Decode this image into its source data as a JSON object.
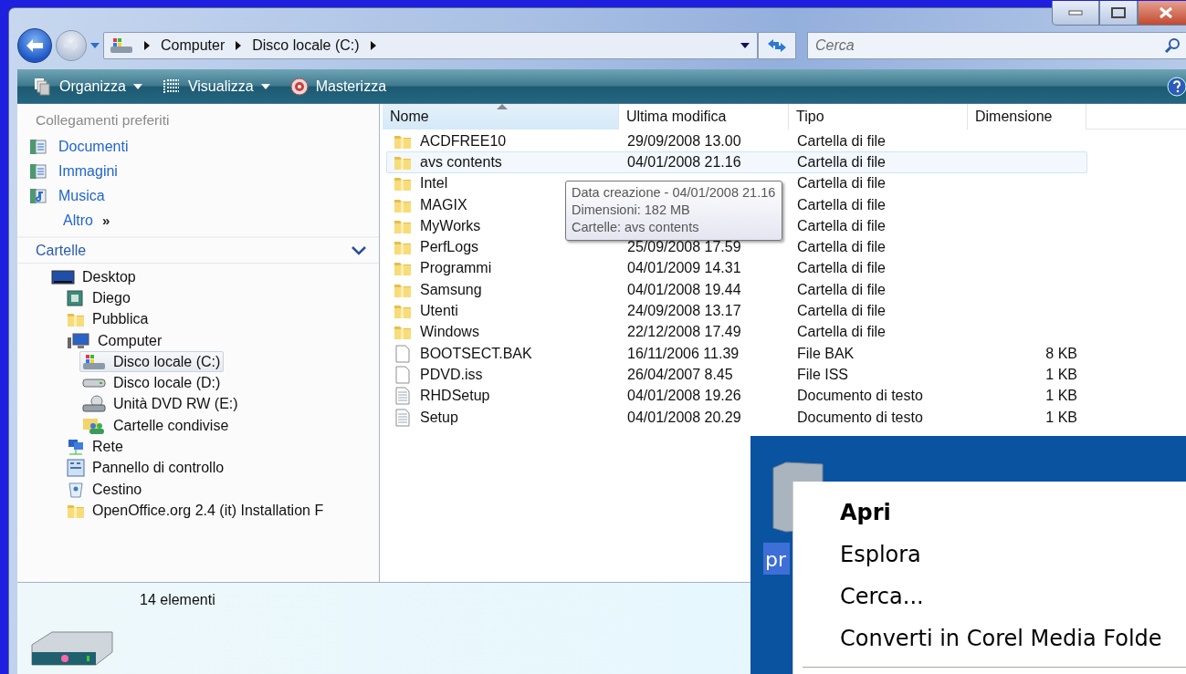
{
  "address_bar": {
    "crumbs": [
      "Computer",
      "Disco locale (C:)"
    ]
  },
  "search": {
    "placeholder": "Cerca"
  },
  "toolbar": {
    "items": [
      {
        "label": "Organizza",
        "kind": "organize",
        "dropdown": true
      },
      {
        "label": "Visualizza",
        "kind": "views",
        "dropdown": true
      },
      {
        "label": "Masterizza",
        "kind": "burn",
        "dropdown": false
      }
    ]
  },
  "sidebar": {
    "favorites_title": "Collegamenti preferiti",
    "favorites": [
      {
        "label": "Documenti",
        "kind": "documents"
      },
      {
        "label": "Immagini",
        "kind": "pictures"
      },
      {
        "label": "Musica",
        "kind": "music"
      }
    ],
    "more": "Altro",
    "more_glyph": "»",
    "folders_title": "Cartelle",
    "tree": [
      {
        "label": "Desktop",
        "kind": "desktop",
        "selected": false,
        "children": [
          {
            "label": "Diego",
            "kind": "user",
            "selected": false
          },
          {
            "label": "Pubblica",
            "kind": "folder",
            "selected": false
          },
          {
            "label": "Computer",
            "kind": "computer",
            "selected": false,
            "children": [
              {
                "label": "Disco locale (C:)",
                "kind": "windrive",
                "selected": true
              },
              {
                "label": "Disco locale (D:)",
                "kind": "drive",
                "selected": false
              },
              {
                "label": "Unità DVD RW (E:)",
                "kind": "dvd",
                "selected": false
              },
              {
                "label": "Cartelle condivise",
                "kind": "shared",
                "selected": false
              }
            ]
          },
          {
            "label": "Rete",
            "kind": "network",
            "selected": false
          },
          {
            "label": "Pannello di controllo",
            "kind": "control",
            "selected": false
          },
          {
            "label": "Cestino",
            "kind": "recycle",
            "selected": false
          },
          {
            "label": "OpenOffice.org 2.4 (it) Installation F",
            "kind": "folder",
            "selected": false
          }
        ]
      }
    ]
  },
  "table": {
    "columns": [
      {
        "label": "Nome",
        "sorted": true
      },
      {
        "label": "Ultima modifica",
        "sorted": false
      },
      {
        "label": "Tipo",
        "sorted": false
      },
      {
        "label": "Dimensione",
        "sorted": false
      }
    ],
    "rows": [
      {
        "name": "ACDFREE10",
        "kind": "folder",
        "modified": "29/09/2008 13.00",
        "type": "Cartella di file",
        "hovered": false
      },
      {
        "name": "avs contents",
        "kind": "folder",
        "modified": "04/01/2008 21.16",
        "type": "Cartella di file",
        "hovered": true
      },
      {
        "name": "Intel",
        "kind": "folder",
        "type": "Cartella di file",
        "hovered": false
      },
      {
        "name": "MAGIX",
        "kind": "folder",
        "type": "Cartella di file",
        "hovered": false
      },
      {
        "name": "MyWorks",
        "kind": "folder",
        "type": "Cartella di file",
        "hovered": false
      },
      {
        "name": "PerfLogs",
        "kind": "folder",
        "modified": "25/09/2008 17.59",
        "type": "Cartella di file",
        "hovered": false
      },
      {
        "name": "Programmi",
        "kind": "folder",
        "modified": "04/01/2009 14.31",
        "type": "Cartella di file",
        "hovered": false
      },
      {
        "name": "Samsung",
        "kind": "folder",
        "modified": "04/01/2008 19.44",
        "type": "Cartella di file",
        "hovered": false
      },
      {
        "name": "Utenti",
        "kind": "folder",
        "modified": "24/09/2008 13.17",
        "type": "Cartella di file",
        "hovered": false
      },
      {
        "name": "Windows",
        "kind": "folder",
        "modified": "22/12/2008 17.49",
        "type": "Cartella di file",
        "hovered": false
      },
      {
        "name": "BOOTSECT.BAK",
        "kind": "file",
        "modified": "16/11/2006 11.39",
        "type": "File BAK",
        "size": "8 KB",
        "hovered": false
      },
      {
        "name": "PDVD.iss",
        "kind": "file",
        "modified": "26/04/2007 8.45",
        "type": "File ISS",
        "size": "1 KB",
        "hovered": false
      },
      {
        "name": "RHDSetup",
        "kind": "text",
        "modified": "04/01/2008 19.26",
        "type": "Documento di testo",
        "size": "1 KB",
        "hovered": false
      },
      {
        "name": "Setup",
        "kind": "text",
        "modified": "04/01/2008 20.29",
        "type": "Documento di testo",
        "size": "1 KB",
        "hovered": false
      }
    ]
  },
  "tooltip": {
    "lines": [
      "Data creazione - 04/01/2008 21.16",
      "Dimensioni: 182 MB",
      "Cartelle: avs contents"
    ]
  },
  "status": {
    "count": "14 elementi"
  },
  "overlay": {
    "icon_label": "pr",
    "menu": [
      {
        "label": "Apri",
        "default": true
      },
      {
        "label": "Esplora",
        "default": false
      },
      {
        "label": "Cerca...",
        "default": false
      },
      {
        "label": "Converti in Corel Media Folde",
        "default": false
      }
    ]
  }
}
